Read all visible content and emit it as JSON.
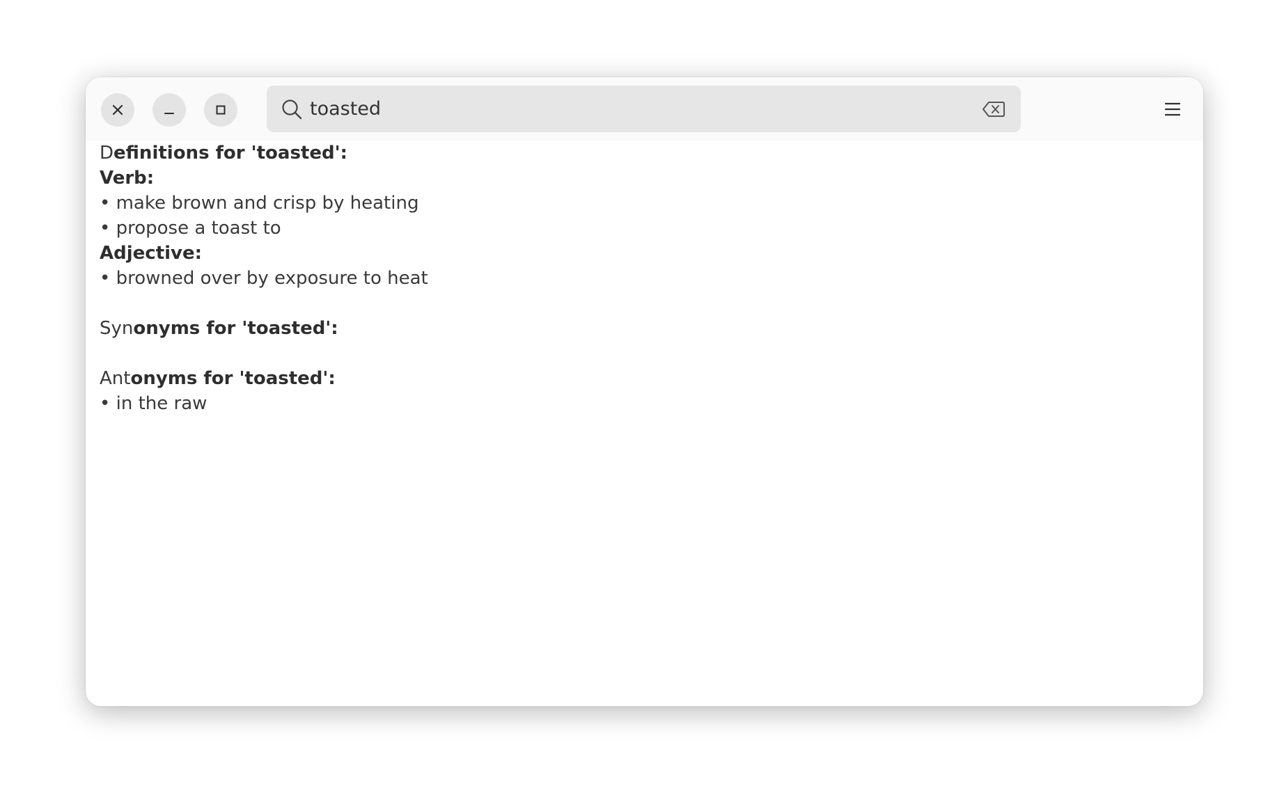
{
  "search": {
    "value": "toasted"
  },
  "definitions": {
    "heading_first": "D",
    "heading_rest": "efinitions for 'toasted':",
    "verb_label": "Verb:",
    "verb_items": [
      "• make brown and crisp by heating",
      "• propose a toast to"
    ],
    "adjective_label": "Adjective:",
    "adjective_items": [
      "• browned over by exposure to heat"
    ]
  },
  "synonyms": {
    "heading_first": "Syn",
    "heading_rest": "onyms for 'toasted':"
  },
  "antonyms": {
    "heading_first": "Ant",
    "heading_rest": "onyms for 'toasted':",
    "items": [
      "• in the raw"
    ]
  },
  "icons": {
    "close": "close-icon",
    "minimize": "minimize-icon",
    "maximize": "maximize-icon",
    "search": "search-icon",
    "clear": "backspace-clear-icon",
    "menu": "hamburger-menu-icon"
  }
}
